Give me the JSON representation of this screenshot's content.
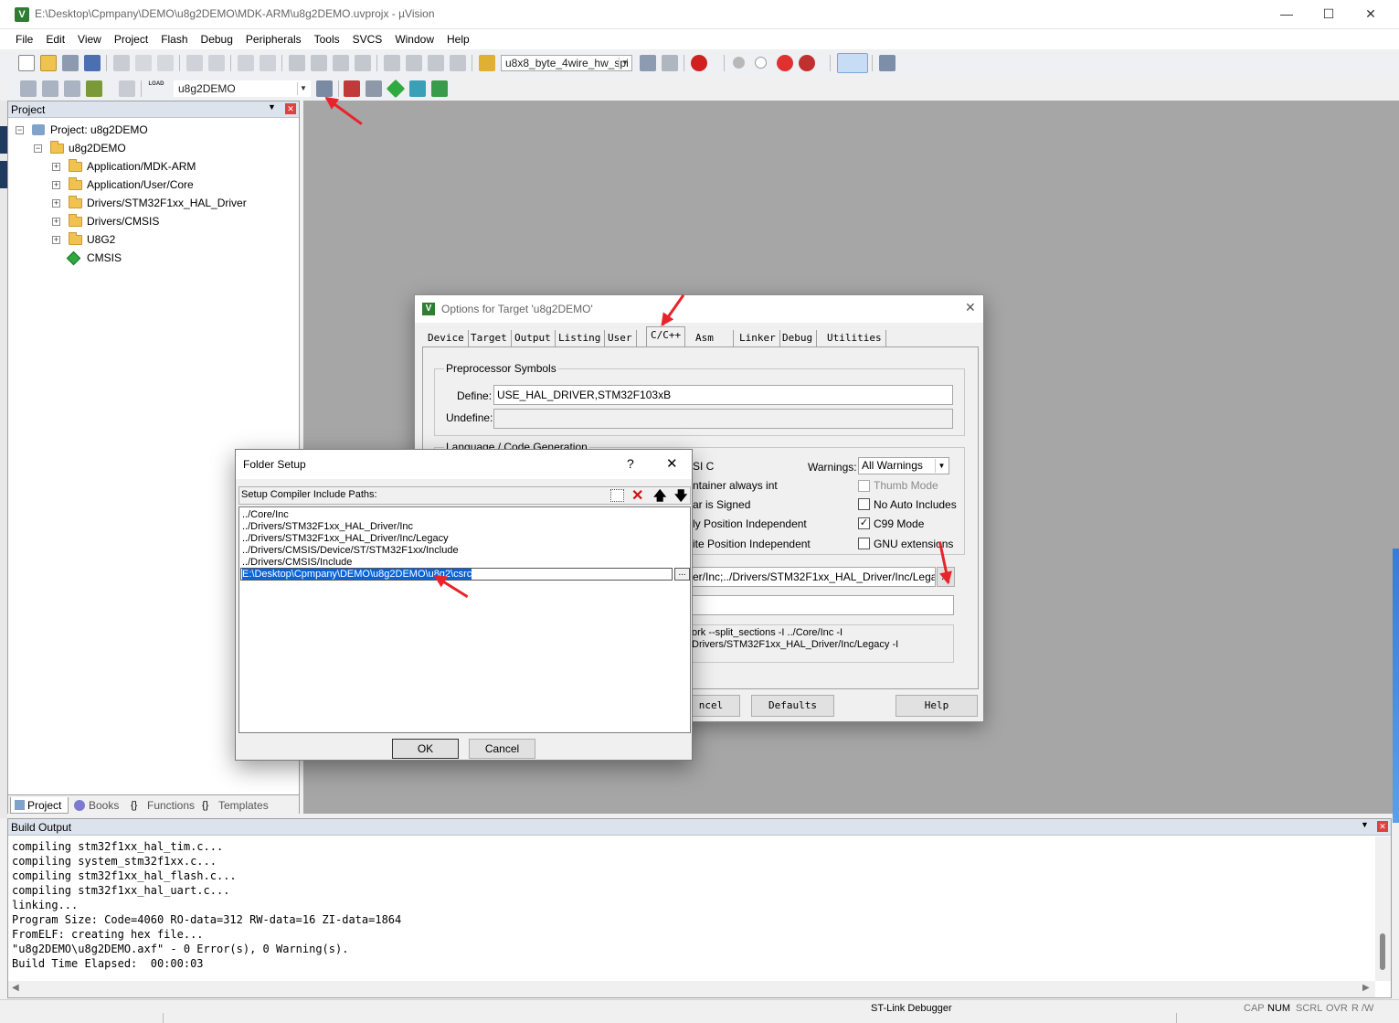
{
  "window": {
    "title": "E:\\Desktop\\Cpmpany\\DEMO\\u8g2DEMO\\MDK-ARM\\u8g2DEMO.uvprojx - µVision",
    "app_icon_letter": "V",
    "minimize": "—",
    "maximize": "☐",
    "close": "✕"
  },
  "menu": [
    "File",
    "Edit",
    "View",
    "Project",
    "Flash",
    "Debug",
    "Peripherals",
    "Tools",
    "SVCS",
    "Window",
    "Help"
  ],
  "toolbar": {
    "find_combo": "u8x8_byte_4wire_hw_spi",
    "target_combo": "u8g2DEMO",
    "load_label": "LOAD"
  },
  "project_panel": {
    "title": "Project",
    "pin": "📌",
    "close": "✕",
    "root": "Project: u8g2DEMO",
    "target": "u8g2DEMO",
    "groups": [
      "Application/MDK-ARM",
      "Application/User/Core",
      "Drivers/STM32F1xx_HAL_Driver",
      "Drivers/CMSIS",
      "U8G2"
    ],
    "cmsis": "CMSIS",
    "tabs": [
      "Project",
      "Books",
      "Functions",
      "Templates"
    ],
    "tab_icons": [
      "",
      "",
      "{}",
      "{}"
    ]
  },
  "build_output": {
    "title": "Build Output",
    "lines": [
      "compiling stm32f1xx_hal_tim.c...",
      "compiling system_stm32f1xx.c...",
      "compiling stm32f1xx_hal_flash.c...",
      "compiling stm32f1xx_hal_uart.c...",
      "linking...",
      "Program Size: Code=4060 RO-data=312 RW-data=16 ZI-data=1864",
      "FromELF: creating hex file...",
      "\"u8g2DEMO\\u8g2DEMO.axf\" - 0 Error(s), 0 Warning(s).",
      "Build Time Elapsed:  00:00:03"
    ]
  },
  "status_bar": {
    "debugger": "ST-Link Debugger",
    "cap": "CAP",
    "num": "NUM",
    "scrl": "SCRL",
    "ovr": "OVR",
    "rw": "R /W"
  },
  "options_dialog": {
    "title": "Options for Target 'u8g2DEMO'",
    "tabs": [
      "Device",
      "Target",
      "Output",
      "Listing",
      "User",
      "C/C++",
      "Asm",
      "Linker",
      "Debug",
      "Utilities"
    ],
    "active_tab": "C/C++",
    "preprocessor_group": "Preprocessor Symbols",
    "define_label": "Define:",
    "define_value": "USE_HAL_DRIVER,STM32F103xB",
    "undefine_label": "Undefine:",
    "undefine_value": "",
    "language_group": "Language / Code Generation",
    "partial_options": [
      "SI C",
      "ntainer always int",
      "ar is Signed",
      "ly Position Independent",
      "ite Position Independent"
    ],
    "warnings_label": "Warnings:",
    "warnings_value": "All Warnings",
    "thumb_mode": "Thumb Mode",
    "no_auto_includes": "No Auto Includes",
    "c99_mode": "C99 Mode",
    "c99_checked": true,
    "gnu_extensions": "GNU extensions",
    "include_paths_partial": "er/Inc;../Drivers/STM32F1xx_HAL_Driver/Inc/Legacy;",
    "browse_label": "...",
    "misc_controls": "",
    "compiler_string_line1": "ork --split_sections -I ../Core/Inc -I",
    "compiler_string_line2": "Drivers/STM32F1xx_HAL_Driver/Inc/Legacy -I",
    "cancel_partial": "ncel",
    "defaults": "Defaults",
    "help": "Help"
  },
  "folder_setup": {
    "title": "Folder Setup",
    "help_icon": "?",
    "close_icon": "✕",
    "header": "Setup Compiler Include Paths:",
    "paths": [
      "../Core/Inc",
      "../Drivers/STM32F1xx_HAL_Driver/Inc",
      "../Drivers/STM32F1xx_HAL_Driver/Inc/Legacy",
      "../Drivers/CMSIS/Device/ST/STM32F1xx/Include",
      "../Drivers/CMSIS/Include"
    ],
    "editing_value": "E:\\Desktop\\Cpmpany\\DEMO\\u8g2DEMO\\u8g2\\csrc",
    "browse_label": "...",
    "ok": "OK",
    "cancel": "Cancel"
  },
  "colors": {
    "accent_selection": "#0a64d8",
    "annotation_arrow": "#e8232a",
    "workspace": "#a6a6a6"
  }
}
